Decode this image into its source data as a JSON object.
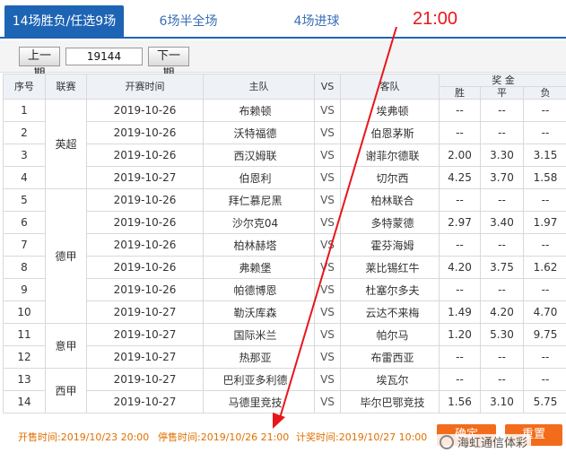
{
  "tabs": [
    {
      "label": "14场胜负/任选9场",
      "active": true
    },
    {
      "label": "6场半全场",
      "active": false
    },
    {
      "label": "4场进球",
      "active": false
    }
  ],
  "annotation_time": "21:00",
  "period": {
    "prev_label": "上一期",
    "current": "19144",
    "next_label": "下一期"
  },
  "table": {
    "headers": {
      "no": "序号",
      "league": "联赛",
      "time": "开赛时间",
      "home": "主队",
      "vs": "VS",
      "away": "客队",
      "prize": "奖 金",
      "win": "胜",
      "draw": "平",
      "lose": "负"
    },
    "rows": [
      {
        "no": "1",
        "date": "2019-10-26",
        "home": "布赖顿",
        "vs": "VS",
        "away": "埃弗顿",
        "win": "--",
        "draw": "--",
        "lose": "--"
      },
      {
        "no": "2",
        "date": "2019-10-26",
        "home": "沃特福德",
        "vs": "VS",
        "away": "伯恩茅斯",
        "win": "--",
        "draw": "--",
        "lose": "--"
      },
      {
        "no": "3",
        "date": "2019-10-26",
        "home": "西汉姆联",
        "vs": "VS",
        "away": "谢菲尔德联",
        "win": "2.00",
        "draw": "3.30",
        "lose": "3.15"
      },
      {
        "no": "4",
        "date": "2019-10-27",
        "home": "伯恩利",
        "vs": "VS",
        "away": "切尔西",
        "win": "4.25",
        "draw": "3.70",
        "lose": "1.58"
      },
      {
        "no": "5",
        "date": "2019-10-26",
        "home": "拜仁慕尼黑",
        "vs": "VS",
        "away": "柏林联合",
        "win": "--",
        "draw": "--",
        "lose": "--"
      },
      {
        "no": "6",
        "date": "2019-10-26",
        "home": "沙尔克04",
        "vs": "VS",
        "away": "多特蒙德",
        "win": "2.97",
        "draw": "3.40",
        "lose": "1.97"
      },
      {
        "no": "7",
        "date": "2019-10-26",
        "home": "柏林赫塔",
        "vs": "VS",
        "away": "霍芬海姆",
        "win": "--",
        "draw": "--",
        "lose": "--"
      },
      {
        "no": "8",
        "date": "2019-10-26",
        "home": "弗赖堡",
        "vs": "VS",
        "away": "莱比锡红牛",
        "win": "4.20",
        "draw": "3.75",
        "lose": "1.62"
      },
      {
        "no": "9",
        "date": "2019-10-26",
        "home": "帕德博恩",
        "vs": "VS",
        "away": "杜塞尔多夫",
        "win": "--",
        "draw": "--",
        "lose": "--"
      },
      {
        "no": "10",
        "date": "2019-10-27",
        "home": "勒沃库森",
        "vs": "VS",
        "away": "云达不来梅",
        "win": "1.49",
        "draw": "4.20",
        "lose": "4.70"
      },
      {
        "no": "11",
        "date": "2019-10-27",
        "home": "国际米兰",
        "vs": "VS",
        "away": "帕尔马",
        "win": "1.20",
        "draw": "5.30",
        "lose": "9.75"
      },
      {
        "no": "12",
        "date": "2019-10-27",
        "home": "热那亚",
        "vs": "VS",
        "away": "布雷西亚",
        "win": "--",
        "draw": "--",
        "lose": "--"
      },
      {
        "no": "13",
        "date": "2019-10-27",
        "home": "巴利亚多利德",
        "vs": "VS",
        "away": "埃瓦尔",
        "win": "--",
        "draw": "--",
        "lose": "--"
      },
      {
        "no": "14",
        "date": "2019-10-27",
        "home": "马德里竞技",
        "vs": "VS",
        "away": "毕尔巴鄂竞技",
        "win": "1.56",
        "draw": "3.10",
        "lose": "5.75"
      }
    ],
    "leagues": [
      {
        "name": "英超",
        "span": 4
      },
      {
        "name": "德甲",
        "span": 6
      },
      {
        "name": "意甲",
        "span": 2
      },
      {
        "name": "西甲",
        "span": 2
      }
    ]
  },
  "footer": {
    "sale_start": "开售时间:2019/10/23 20:00",
    "sale_stop": "停售时间:2019/10/26 21:00",
    "draw_time": "计奖时间:2019/10/27 10:00",
    "confirm_label": "确定",
    "reset_label": "重置"
  },
  "watermark": "海虹通信体彩",
  "colors": {
    "accent": "#1e64b4",
    "footer_text": "#e07000",
    "button": "#f26c1b",
    "annotation": "#e8161b"
  }
}
